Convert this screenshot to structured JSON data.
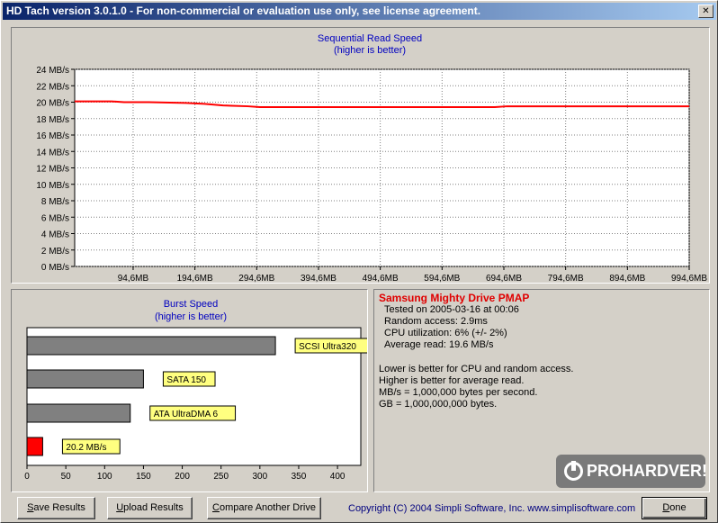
{
  "window": {
    "title": "HD Tach version 3.0.1.0  - For non-commercial or evaluation use only, see license agreement.",
    "close_glyph": "✕"
  },
  "sequential": {
    "title_line1": "Sequential Read Speed",
    "title_line2": "(higher is better)"
  },
  "burst": {
    "title_line1": "Burst Speed",
    "title_line2": "(higher is better)"
  },
  "chart_data": [
    {
      "type": "line",
      "title": "Sequential Read Speed",
      "subtitle": "(higher is better)",
      "ylim": [
        0,
        24
      ],
      "y_ticks": [
        "0 MB/s",
        "2 MB/s",
        "4 MB/s",
        "6 MB/s",
        "8 MB/s",
        "10 MB/s",
        "12 MB/s",
        "14 MB/s",
        "16 MB/s",
        "18 MB/s",
        "20 MB/s",
        "22 MB/s",
        "24 MB/s"
      ],
      "x_ticks": [
        "94,6MB",
        "194,6MB",
        "294,6MB",
        "394,6MB",
        "494,6MB",
        "594,6MB",
        "694,6MB",
        "794,6MB",
        "894,6MB",
        "994,6MB"
      ],
      "xlim": [
        0,
        994.6
      ],
      "grid": true,
      "line_color": "#ff0000",
      "series": [
        {
          "x": [
            0,
            40,
            60,
            80,
            100,
            120,
            180,
            210,
            240,
            280,
            300,
            400,
            500,
            600,
            650,
            680,
            700,
            800,
            900,
            994.6
          ],
          "values": [
            20.1,
            20.1,
            20.1,
            20.0,
            20.0,
            20.0,
            19.9,
            19.8,
            19.6,
            19.5,
            19.4,
            19.4,
            19.4,
            19.4,
            19.4,
            19.4,
            19.5,
            19.5,
            19.5,
            19.5
          ]
        }
      ]
    },
    {
      "type": "bar",
      "orientation": "horizontal",
      "title": "Burst Speed",
      "subtitle": "(higher is better)",
      "xlim": [
        0,
        430
      ],
      "x_ticks": [
        0,
        50,
        100,
        150,
        200,
        250,
        300,
        350,
        400
      ],
      "categories": [
        "SCSI Ultra320",
        "SATA 150",
        "ATA UltraDMA 6",
        "20.2 MB/s"
      ],
      "values": [
        320,
        150,
        133,
        20.2
      ],
      "colors": [
        "#808080",
        "#808080",
        "#808080",
        "#ff0000"
      ],
      "label_color": "#ffff80"
    }
  ],
  "info": {
    "drive_name": "Samsung Mighty Drive PMAP",
    "tested_on": "Tested on 2005-03-16 at 00:06",
    "random_access": "Random access: 2.9ms",
    "cpu_utilization": "CPU utilization: 6% (+/- 2%)",
    "average_read": "Average read: 19.6 MB/s",
    "note1": "Lower is better for CPU and random access.",
    "note2": "Higher is better for average read.",
    "note3": "MB/s = 1,000,000 bytes per second.",
    "note4": "GB = 1,000,000,000 bytes.",
    "logo_text": "PROHARDVER!"
  },
  "buttons": {
    "save_u": "S",
    "save_rest": "ave Results",
    "upload_u": "U",
    "upload_rest": "pload Results",
    "compare_u": "C",
    "compare_rest": "ompare Another Drive",
    "done_u": "D",
    "done_rest": "one"
  },
  "copyright": "Copyright (C) 2004 Simpli Software, Inc. www.simplisoftware.com"
}
